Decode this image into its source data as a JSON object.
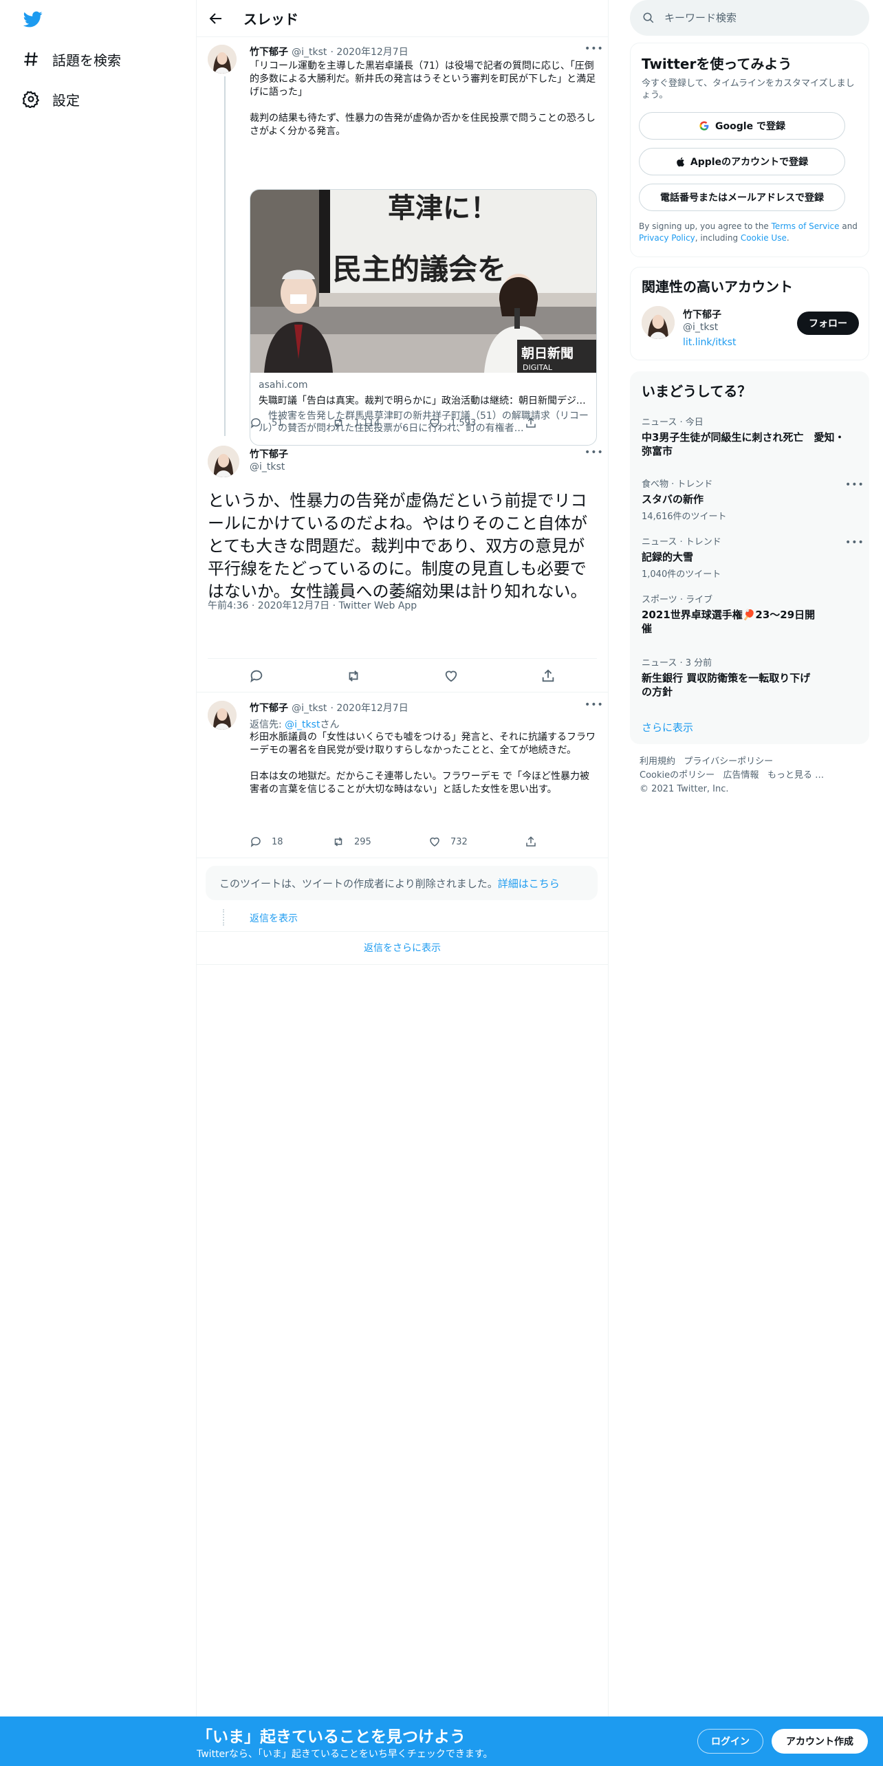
{
  "colors": {
    "accent": "#1d9bf0",
    "text": "#0f1419",
    "muted": "#536471",
    "border": "#eff3f4"
  },
  "nav": {
    "items": [
      {
        "icon": "hashtag-icon",
        "label": "話題を検索"
      },
      {
        "icon": "gear-icon",
        "label": "設定"
      }
    ]
  },
  "header": {
    "title": "スレッド"
  },
  "tweet1": {
    "name": "竹下郁子",
    "handle": "@i_tkst",
    "date": "· 2020年12月7日",
    "text": "「リコール運動を主導した黒岩卓議長（71）は役場で記者の質問に応じ、「圧倒的多数による大勝利だ。新井氏の発言はうそという審判を町民が下した」と満足げに語った」\n\n裁判の結果も待たず、性暴力の告発が虚偽か否かを住民投票で問うことの恐ろしさがよく分かる発言。",
    "card": {
      "image_banner_1": "草津に！",
      "image_banner_2": "民主的議会を",
      "image_logo_1": "朝日新聞",
      "image_logo_2": "DIGITAL",
      "domain": "asahi.com",
      "title": "失職町議「告白は真実。裁判で明らかに」政治活動は継続：朝日新聞デジタル",
      "desc": "　性被害を告発した群馬県草津町の新井祥子町議（51）の解職請求（リコール）の賛否が問われた住民投票が6日に行われ、町の有権者…"
    },
    "replies": "51",
    "retweets": "1,114",
    "likes": "1,593"
  },
  "main_tweet": {
    "name": "竹下郁子",
    "handle": "@i_tkst",
    "text": "というか、性暴力の告発が虚偽だという前提でリコールにかけているのだよね。やはりそのこと自体がとても大きな問題だ。裁判中であり、双方の意見が平行線をたどっているのに。制度の見直しも必要ではないか。女性議員への萎縮効果は計り知れない。",
    "meta": "午前4:36 · 2020年12月7日 · Twitter Web App"
  },
  "reply_tweet": {
    "name": "竹下郁子",
    "handle": "@i_tkst",
    "date": "· 2020年12月7日",
    "reply_prefix": "返信先: ",
    "reply_handle": "@i_tkst",
    "reply_suffix": "さん",
    "text": "杉田水脈議員の「女性はいくらでも嘘をつける」発言と、それに抗議するフラワーデモの署名を自民党が受け取りすらしなかったことと、全てが地続きだ。\n\n日本は女の地獄だ。だからこそ連帯したい。フラワーデモ で「今ほど性暴力被害者の言葉を信じることが大切な時はない」と話した女性を思い出す。",
    "replies": "18",
    "retweets": "295",
    "likes": "732"
  },
  "deleted_notice": {
    "text": "このツイートは、ツイートの作成者により削除されました。",
    "link": "詳細はこちら"
  },
  "show_replies": "返信を表示",
  "show_more_replies": "返信をさらに表示",
  "search": {
    "placeholder": "キーワード検索"
  },
  "signup_panel": {
    "title": "Twitterを使ってみよう",
    "subtitle": "今すぐ登録して、タイムラインをカスタマイズしましょう。",
    "google": "Google で登録",
    "apple": "Appleのアカウントで登録",
    "phone": "電話番号またはメールアドレスで登録",
    "terms_1": "By signing up, you agree to the ",
    "terms_link": "Terms of Service",
    "terms_2": " and ",
    "privacy_link": "Privacy Policy",
    "terms_3": ", including ",
    "cookie_link": "Cookie Use",
    "terms_4": "."
  },
  "related": {
    "title": "関連性の高いアカウント",
    "name": "竹下郁子",
    "handle": "@i_tkst",
    "link": "lit.link/itkst",
    "follow": "フォロー"
  },
  "trends": {
    "title": "いまどうしてる？",
    "items": [
      {
        "category": "ニュース · 今日",
        "name": "中3男子生徒が同級生に刺され死亡　愛知・弥富市",
        "count": ""
      },
      {
        "category": "食べ物 · トレンド",
        "name": "スタバの新作",
        "count": "14,616件のツイート"
      },
      {
        "category": "ニュース · トレンド",
        "name": "記録的大雪",
        "count": "1,040件のツイート"
      },
      {
        "category": "スポーツ · ライブ",
        "name": "2021世界卓球選手権🏓23〜29日開催",
        "count": ""
      },
      {
        "category": "ニュース · 3 分前",
        "name": "新生銀行 買収防衛策を一転取り下げの方針",
        "count": ""
      }
    ],
    "more": "さらに表示"
  },
  "footer": {
    "terms": "利用規約",
    "privacy": "プライバシーポリシー",
    "cookie": "Cookieのポリシー",
    "ads": "広告情報",
    "more": "もっと見る …",
    "copyright": "© 2021 Twitter, Inc."
  },
  "bottom_bar": {
    "title": "「いま」起きていることを見つけよう",
    "subtitle": "Twitterなら、「いま」起きていることをいち早くチェックできます。",
    "login": "ログイン",
    "signup": "アカウント作成"
  }
}
